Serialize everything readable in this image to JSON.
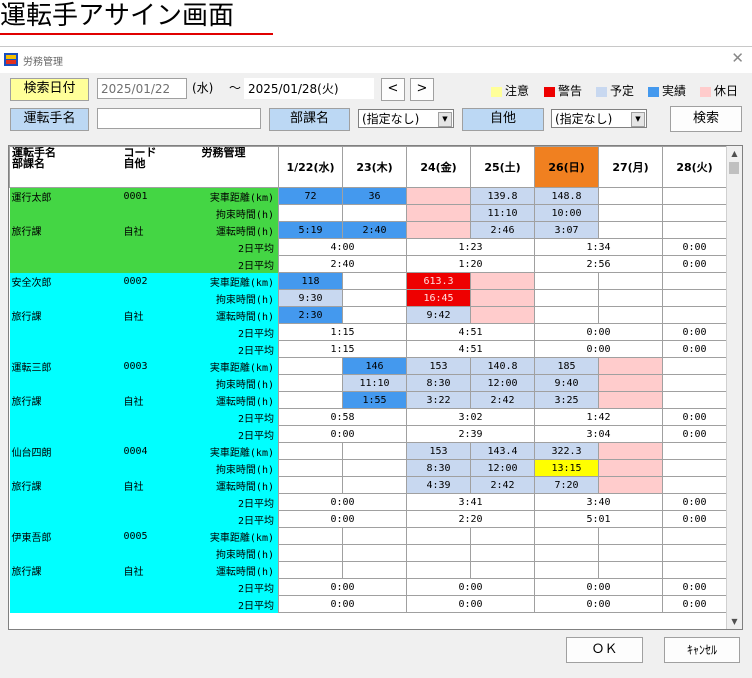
{
  "page_title": "運転手アサイン画面",
  "window_title": "労務管理",
  "colors": {
    "green": "#44d644",
    "cyan": "#00ffff",
    "plan": "#c8d8f0",
    "actual": "#4499ee",
    "warn": "#ee0000",
    "caution": "#ffff00",
    "holiday": "#ffcccc",
    "today": "#f08020"
  },
  "toolbar": {
    "search_date_label": "検索日付",
    "date_from": "2025/01/22",
    "date_from_dow": "(水)",
    "tilde": "～",
    "date_to": "2025/01/28(火)",
    "prev_label": "<",
    "next_label": ">",
    "driver_name_label": "運転手名",
    "driver_name_value": "",
    "dept_label": "部課名",
    "dept_value": "(指定なし)",
    "other_label": "自他",
    "other_value": "(指定なし)",
    "search_button": "検索"
  },
  "legend": [
    {
      "label": "注意",
      "color": "#ffff99"
    },
    {
      "label": "警告",
      "color": "#ee0000"
    },
    {
      "label": "予定",
      "color": "#c8d8f0"
    },
    {
      "label": "実績",
      "color": "#4499ee"
    },
    {
      "label": "休日",
      "color": "#ffcccc"
    }
  ],
  "grid": {
    "header": {
      "col1a": "運転手名",
      "col1b": "部課名",
      "col2a": "コード",
      "col2b": "自他",
      "col3": "労務管理"
    },
    "dates": [
      "1/22(水)",
      "23(木)",
      "24(金)",
      "25(土)",
      "26(日)",
      "27(月)",
      "28(火)"
    ],
    "highlight_date_index": 4,
    "row_labels": [
      "実車距離(km)",
      "拘束時間(h)",
      "運転時間(h)",
      "2日平均",
      "2日平均"
    ],
    "drivers": [
      {
        "name": "運行太郎",
        "dept": "旅行課",
        "code": "0001",
        "type": "自社",
        "color": "green",
        "rows": [
          [
            {
              "v": "72",
              "c": "actual"
            },
            {
              "v": "36",
              "c": "actual"
            },
            {
              "v": "",
              "c": "holiday"
            },
            {
              "v": "139.8",
              "c": "plan"
            },
            {
              "v": "148.8",
              "c": "plan"
            },
            {
              "v": "",
              "c": ""
            },
            {
              "v": "",
              "c": ""
            }
          ],
          [
            {
              "v": "",
              "c": ""
            },
            {
              "v": "",
              "c": ""
            },
            {
              "v": "",
              "c": "holiday"
            },
            {
              "v": "11:10",
              "c": "plan"
            },
            {
              "v": "10:00",
              "c": "plan"
            },
            {
              "v": "",
              "c": ""
            },
            {
              "v": "",
              "c": ""
            }
          ],
          [
            {
              "v": "5:19",
              "c": "actual"
            },
            {
              "v": "2:40",
              "c": "actual"
            },
            {
              "v": "",
              "c": "holiday"
            },
            {
              "v": "2:46",
              "c": "plan"
            },
            {
              "v": "3:07",
              "c": "plan"
            },
            {
              "v": "",
              "c": ""
            },
            {
              "v": "",
              "c": ""
            }
          ]
        ],
        "avg1": [
          "4:00",
          "1:23",
          "1:34",
          "0:00"
        ],
        "avg2": [
          "2:40",
          "1:20",
          "2:56",
          "0:00"
        ]
      },
      {
        "name": "安全次郎",
        "dept": "旅行課",
        "code": "0002",
        "type": "自社",
        "color": "cyan",
        "rows": [
          [
            {
              "v": "118",
              "c": "actual"
            },
            {
              "v": "",
              "c": ""
            },
            {
              "v": "613.3",
              "c": "warn"
            },
            {
              "v": "",
              "c": "holiday"
            },
            {
              "v": "",
              "c": ""
            },
            {
              "v": "",
              "c": ""
            },
            {
              "v": "",
              "c": ""
            }
          ],
          [
            {
              "v": "9:30",
              "c": "plan"
            },
            {
              "v": "",
              "c": ""
            },
            {
              "v": "16:45",
              "c": "warn"
            },
            {
              "v": "",
              "c": "holiday"
            },
            {
              "v": "",
              "c": ""
            },
            {
              "v": "",
              "c": ""
            },
            {
              "v": "",
              "c": ""
            }
          ],
          [
            {
              "v": "2:30",
              "c": "actual"
            },
            {
              "v": "",
              "c": ""
            },
            {
              "v": "9:42",
              "c": "plan"
            },
            {
              "v": "",
              "c": "holiday"
            },
            {
              "v": "",
              "c": ""
            },
            {
              "v": "",
              "c": ""
            },
            {
              "v": "",
              "c": ""
            }
          ]
        ],
        "avg1": [
          "1:15",
          "4:51",
          "0:00",
          "0:00"
        ],
        "avg2": [
          "1:15",
          "4:51",
          "0:00",
          "0:00"
        ]
      },
      {
        "name": "運転三郎",
        "dept": "旅行課",
        "code": "0003",
        "type": "自社",
        "color": "cyan",
        "rows": [
          [
            {
              "v": "",
              "c": ""
            },
            {
              "v": "146",
              "c": "actual"
            },
            {
              "v": "153",
              "c": "plan"
            },
            {
              "v": "140.8",
              "c": "plan"
            },
            {
              "v": "185",
              "c": "plan"
            },
            {
              "v": "",
              "c": "holiday"
            },
            {
              "v": "",
              "c": ""
            }
          ],
          [
            {
              "v": "",
              "c": ""
            },
            {
              "v": "11:10",
              "c": "plan"
            },
            {
              "v": "8:30",
              "c": "plan"
            },
            {
              "v": "12:00",
              "c": "plan"
            },
            {
              "v": "9:40",
              "c": "plan"
            },
            {
              "v": "",
              "c": "holiday"
            },
            {
              "v": "",
              "c": ""
            }
          ],
          [
            {
              "v": "",
              "c": ""
            },
            {
              "v": "1:55",
              "c": "actual"
            },
            {
              "v": "3:22",
              "c": "plan"
            },
            {
              "v": "2:42",
              "c": "plan"
            },
            {
              "v": "3:25",
              "c": "plan"
            },
            {
              "v": "",
              "c": "holiday"
            },
            {
              "v": "",
              "c": ""
            }
          ]
        ],
        "avg1": [
          "0:58",
          "3:02",
          "1:42",
          "0:00"
        ],
        "avg2": [
          "0:00",
          "2:39",
          "3:04",
          "0:00"
        ]
      },
      {
        "name": "仙台四朗",
        "dept": "旅行課",
        "code": "0004",
        "type": "自社",
        "color": "cyan",
        "rows": [
          [
            {
              "v": "",
              "c": ""
            },
            {
              "v": "",
              "c": ""
            },
            {
              "v": "153",
              "c": "plan"
            },
            {
              "v": "143.4",
              "c": "plan"
            },
            {
              "v": "322.3",
              "c": "plan"
            },
            {
              "v": "",
              "c": "holiday"
            },
            {
              "v": "",
              "c": ""
            }
          ],
          [
            {
              "v": "",
              "c": ""
            },
            {
              "v": "",
              "c": ""
            },
            {
              "v": "8:30",
              "c": "plan"
            },
            {
              "v": "12:00",
              "c": "plan"
            },
            {
              "v": "13:15",
              "c": "caution"
            },
            {
              "v": "",
              "c": "holiday"
            },
            {
              "v": "",
              "c": ""
            }
          ],
          [
            {
              "v": "",
              "c": ""
            },
            {
              "v": "",
              "c": ""
            },
            {
              "v": "4:39",
              "c": "plan"
            },
            {
              "v": "2:42",
              "c": "plan"
            },
            {
              "v": "7:20",
              "c": "plan"
            },
            {
              "v": "",
              "c": "holiday"
            },
            {
              "v": "",
              "c": ""
            }
          ]
        ],
        "avg1": [
          "0:00",
          "3:41",
          "3:40",
          "0:00"
        ],
        "avg2": [
          "0:00",
          "2:20",
          "5:01",
          "0:00"
        ]
      },
      {
        "name": "伊東吾郎",
        "dept": "旅行課",
        "code": "0005",
        "type": "自社",
        "color": "cyan",
        "rows": [
          [
            {
              "v": "",
              "c": ""
            },
            {
              "v": "",
              "c": ""
            },
            {
              "v": "",
              "c": ""
            },
            {
              "v": "",
              "c": ""
            },
            {
              "v": "",
              "c": ""
            },
            {
              "v": "",
              "c": ""
            },
            {
              "v": "",
              "c": ""
            }
          ],
          [
            {
              "v": "",
              "c": ""
            },
            {
              "v": "",
              "c": ""
            },
            {
              "v": "",
              "c": ""
            },
            {
              "v": "",
              "c": ""
            },
            {
              "v": "",
              "c": ""
            },
            {
              "v": "",
              "c": ""
            },
            {
              "v": "",
              "c": ""
            }
          ],
          [
            {
              "v": "",
              "c": ""
            },
            {
              "v": "",
              "c": ""
            },
            {
              "v": "",
              "c": ""
            },
            {
              "v": "",
              "c": ""
            },
            {
              "v": "",
              "c": ""
            },
            {
              "v": "",
              "c": ""
            },
            {
              "v": "",
              "c": ""
            }
          ]
        ],
        "avg1": [
          "0:00",
          "0:00",
          "0:00",
          "0:00"
        ],
        "avg2": [
          "0:00",
          "0:00",
          "0:00",
          "0:00"
        ]
      }
    ]
  },
  "footer": {
    "ok_label": "ＯＫ",
    "cancel_label": "ｷｬﾝｾﾙ"
  }
}
